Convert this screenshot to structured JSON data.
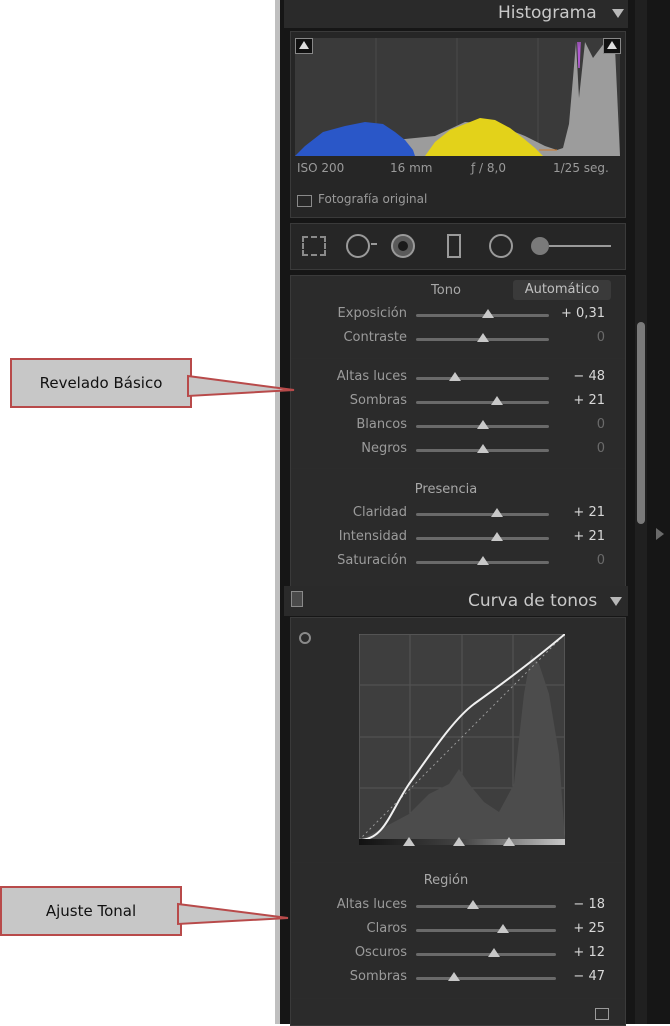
{
  "histogram": {
    "title": "Histograma",
    "iso": "ISO 200",
    "focal": "16 mm",
    "aperture": "ƒ / 8,0",
    "shutter": "1/25 seg.",
    "original_label": "Fotografía original"
  },
  "basic": {
    "tono_label": "Tono",
    "auto_label": "Automático",
    "presencia_label": "Presencia",
    "rows_tono": [
      {
        "label": "Exposición",
        "value": "+ 0,31",
        "pos": 0.54
      },
      {
        "label": "Contraste",
        "value": "0",
        "pos": 0.5
      }
    ],
    "rows_tonal": [
      {
        "label": "Altas luces",
        "value": "− 48",
        "pos": 0.29
      },
      {
        "label": "Sombras",
        "value": "+ 21",
        "pos": 0.61
      },
      {
        "label": "Blancos",
        "value": "0",
        "pos": 0.5
      },
      {
        "label": "Negros",
        "value": "0",
        "pos": 0.5
      }
    ],
    "rows_presencia": [
      {
        "label": "Claridad",
        "value": "+ 21",
        "pos": 0.61
      },
      {
        "label": "Intensidad",
        "value": "+ 21",
        "pos": 0.61
      },
      {
        "label": "Saturación",
        "value": "0",
        "pos": 0.5
      }
    ]
  },
  "curve": {
    "title": "Curva de tonos",
    "region_label": "Región",
    "rows": [
      {
        "label": "Altas luces",
        "value": "− 18",
        "pos": 0.41
      },
      {
        "label": "Claros",
        "value": "+ 25",
        "pos": 0.62
      },
      {
        "label": "Oscuros",
        "value": "+ 12",
        "pos": 0.56
      },
      {
        "label": "Sombras",
        "value": "− 47",
        "pos": 0.27
      }
    ]
  },
  "annotations": {
    "revelado": "Revelado Básico",
    "ajuste": "Ajuste Tonal"
  },
  "colors": {
    "panel_bg": "#2b2b2b",
    "histogram_blue": "#2a57c8",
    "histogram_yellow": "#e3d21a",
    "callout_border": "#b84a4a"
  }
}
